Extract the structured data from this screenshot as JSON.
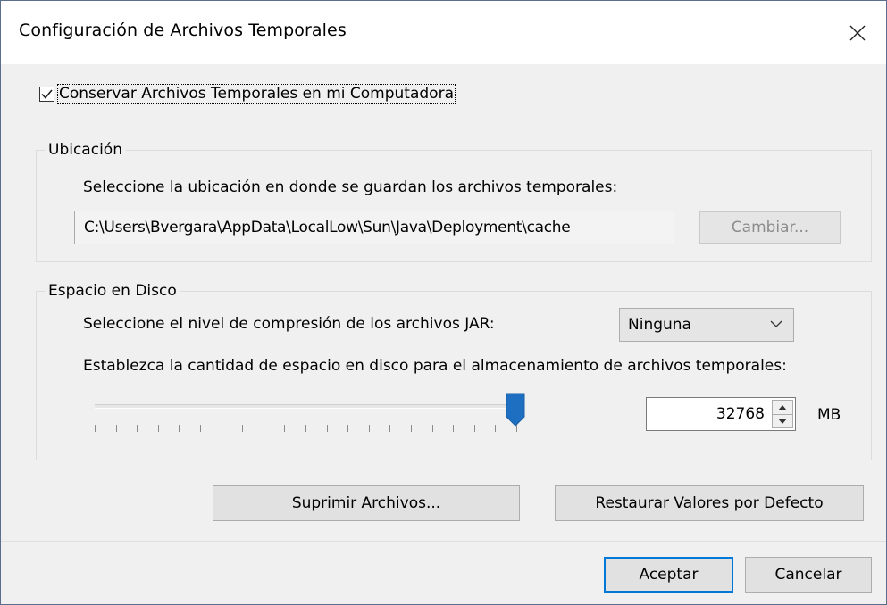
{
  "window": {
    "title": "Configuración de Archivos Temporales",
    "close_icon": "close-icon",
    "colors": {
      "accent": "#0078d7",
      "thumb": "#1e6fc1",
      "background": "#f0f0f0"
    }
  },
  "keep_files": {
    "label": "Conservar Archivos Temporales en mi Computadora",
    "checked": true
  },
  "location": {
    "legend": "Ubicación",
    "prompt": "Seleccione la ubicación en donde se guardan los archivos temporales:",
    "path": "C:\\Users\\Bvergara\\AppData\\LocalLow\\Sun\\Java\\Deployment\\cache",
    "change_button": "Cambiar..."
  },
  "disk": {
    "legend": "Espacio en Disco",
    "compression_prompt": "Seleccione el nivel de compresión de los archivos JAR:",
    "compression_value": "Ninguna",
    "space_prompt": "Establezca la cantidad de espacio en disco para el almacenamiento de archivos temporales:",
    "slider_level": 1.0,
    "space_value": "32768",
    "unit": "MB"
  },
  "actions": {
    "delete_files": "Suprimir Archivos...",
    "restore_defaults": "Restaurar Valores por Defecto"
  },
  "footer": {
    "ok": "Aceptar",
    "cancel": "Cancelar"
  }
}
